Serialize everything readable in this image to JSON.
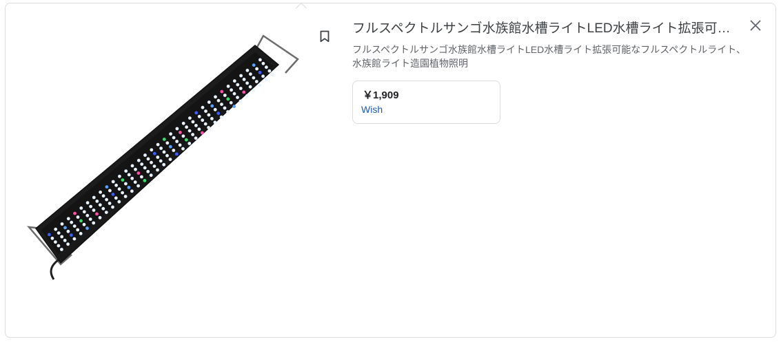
{
  "product": {
    "title": "フルスペクトルサンゴ水族館水槽ライトLED水槽ライト拡張可能なフルスペクトルライト、水族館ライト造園植物照明",
    "description": "フルスペクトルサンゴ水族館水槽ライトLED水槽ライト拡張可能なフルスペクトルライト、水族館ライト造園植物照明"
  },
  "offer": {
    "price": "￥1,909",
    "merchant": "Wish"
  },
  "icons": {
    "bookmark": "bookmark-icon",
    "close": "close-icon"
  },
  "colors": {
    "border": "#dadce0",
    "title": "#3c4043",
    "description": "#5f6368",
    "merchant_link": "#1a5bb3"
  }
}
